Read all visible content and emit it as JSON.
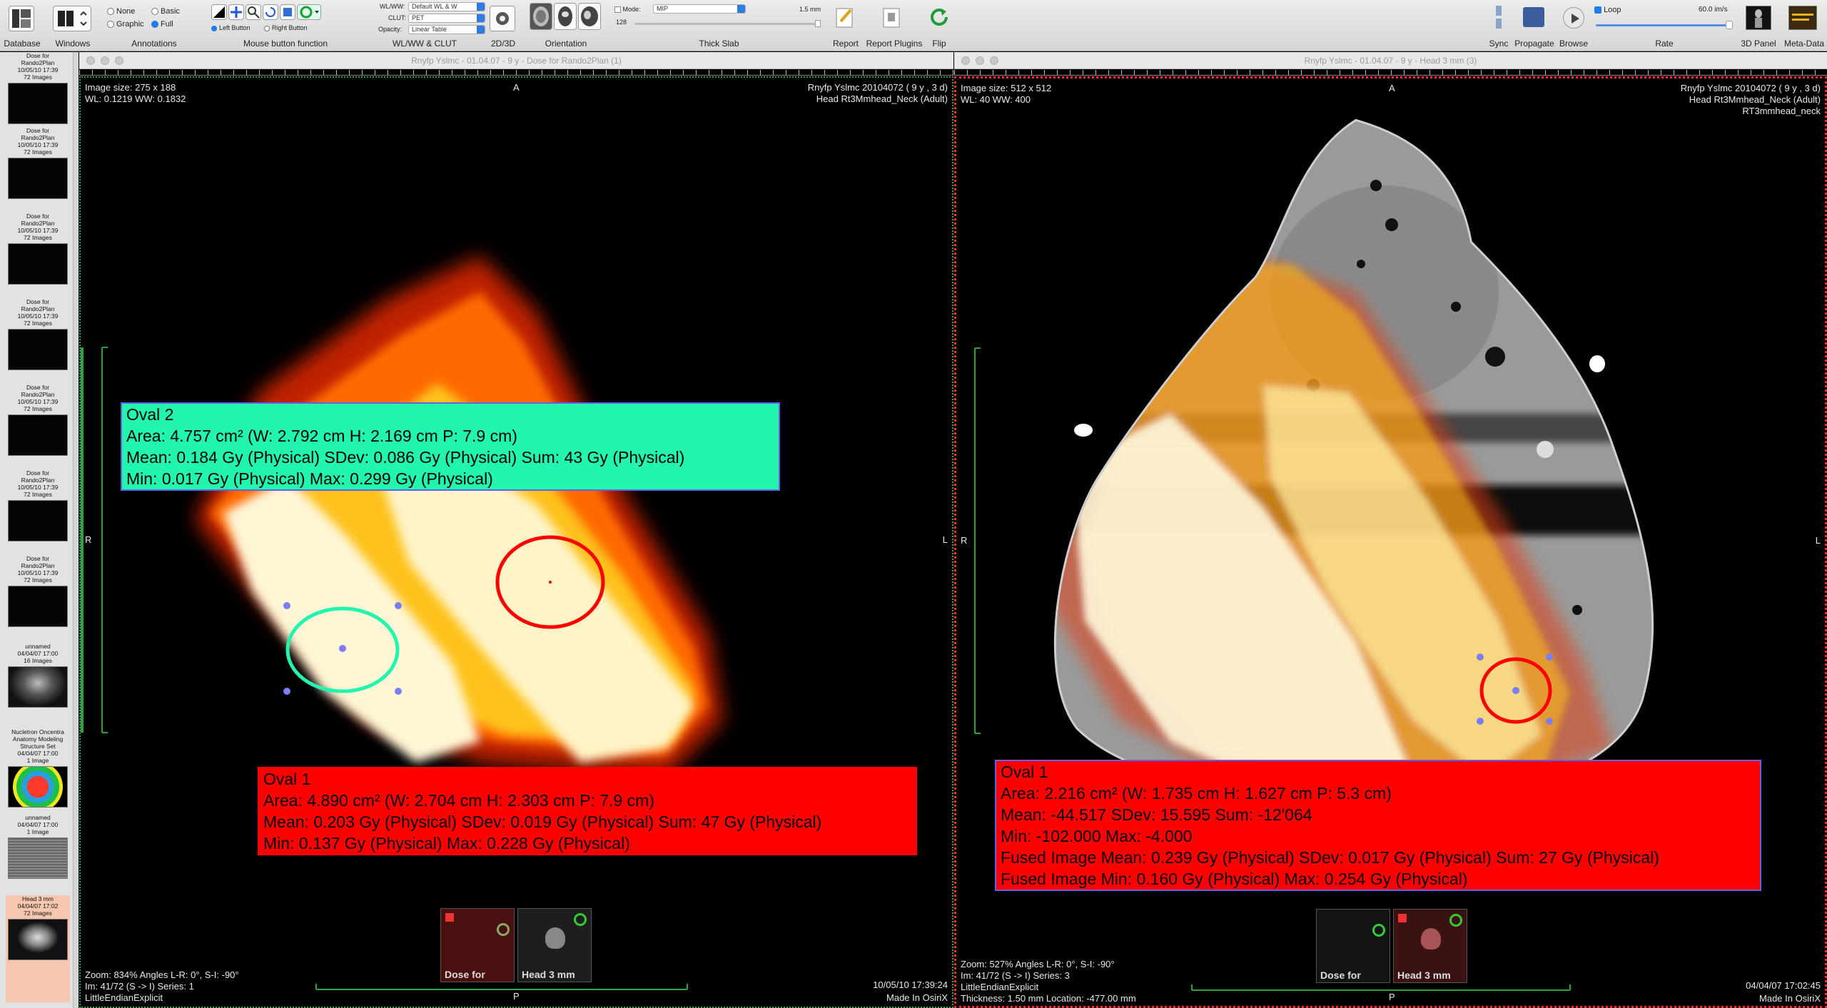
{
  "toolbar": {
    "database": "Database",
    "windows": "Windows",
    "annotations": {
      "label": "Annotations",
      "none": "None",
      "basic": "Basic",
      "graphic": "Graphic",
      "full": "Full"
    },
    "mouse": {
      "label": "Mouse button function",
      "left": "Left Button",
      "right": "Right Button"
    },
    "wlww_clut": {
      "label": "WL/WW & CLUT",
      "wlww_label": "WL/WW:",
      "wlww_value": "Default WL & W",
      "clut_label": "CLUT:",
      "clut_value": "PET",
      "opacity_label": "Opacity:",
      "opacity_value": "Linear Table"
    },
    "twod3d": "2D/3D",
    "orientation": "Orientation",
    "thick_slab": {
      "label": "Thick Slab",
      "mode_label": "Mode:",
      "mode_value": "MIP",
      "thickness": "1.5 mm",
      "count": "128"
    },
    "report": "Report",
    "report_plugins": "Report Plugins",
    "flip": "Flip",
    "sync": "Sync",
    "propagate": "Propagate",
    "browse": "Browse",
    "loop": "Loop",
    "rate": "Rate",
    "rate_value": "60.0 im/s",
    "panel_3d": "3D Panel",
    "metadata": "Meta-Data"
  },
  "sidebar": {
    "items": [
      {
        "l1": "Dose for",
        "l2": "Rando2Plan",
        "l3": "10/05/10 17:39",
        "l4": "72 Images"
      },
      {
        "l1": "Dose for",
        "l2": "Rando2Plan",
        "l3": "10/05/10 17:39",
        "l4": "72 Images"
      },
      {
        "l1": "Dose for",
        "l2": "Rando2Plan",
        "l3": "10/05/10 17:39",
        "l4": "72 Images"
      },
      {
        "l1": "Dose for",
        "l2": "Rando2Plan",
        "l3": "10/05/10 17:39",
        "l4": "72 Images"
      },
      {
        "l1": "Dose for",
        "l2": "Rando2Plan",
        "l3": "10/05/10 17:39",
        "l4": "72 Images"
      },
      {
        "l1": "Dose for",
        "l2": "Rando2Plan",
        "l3": "10/05/10 17:39",
        "l4": "72 Images"
      },
      {
        "l1": "Dose for",
        "l2": "Rando2Plan",
        "l3": "10/05/10 17:39",
        "l4": "72 Images"
      },
      {
        "l1": "unnamed",
        "l2": "04/04/07 17:00",
        "l3": "16 Images",
        "l4": ""
      },
      {
        "l1": "Nucletron Oncentra",
        "l2": "Anatomy Modeling",
        "l3": "Structure Set",
        "l4": "04/04/07 17:00",
        "l5": "1 Image"
      },
      {
        "l1": "unnamed",
        "l2": "04/04/07 17:00",
        "l3": "1 Image",
        "l4": ""
      },
      {
        "l1": "Head 3 mm",
        "l2": "04/04/07 17:02",
        "l3": "72 Images",
        "l4": ""
      }
    ]
  },
  "left_window": {
    "title": "Rnyfp Yslmc - 01.04.07 - 9 y - Dose for Rando2Plan (1)",
    "image_size": "Image size: 275 x 188",
    "wl_ww": "WL: 0.1219 WW: 0.1832",
    "patient": "Rnyfp Yslmc 20104072 ( 9 y , 3 d)",
    "study": "Head Rt3Mmhead_Neck (Adult)",
    "orient_top": "A",
    "orient_left": "R",
    "orient_right": "L",
    "orient_bottom": "P",
    "zoom": "Zoom: 834% Angles L-R: 0°, S-I: -90°",
    "im": "Im: 41/72  (S -> I) Series: 1",
    "encoding": "LittleEndianExplicit",
    "datetime": "10/05/10 17:39:24",
    "made_in": "Made In OsiriX",
    "roi_oval2": {
      "title": "Oval 2",
      "line1": "Area: 4.757 cm² (W: 2.792 cm H: 2.169 cm P: 7.9 cm)",
      "line2": "Mean: 0.184 Gy (Physical)  SDev: 0.086 Gy (Physical)  Sum: 43 Gy (Physical)",
      "line3": "Min: 0.017 Gy (Physical)  Max: 0.299 Gy (Physical)"
    },
    "roi_oval1": {
      "title": "Oval 1",
      "line1": "Area: 4.890 cm² (W: 2.704 cm H: 2.303 cm P: 7.9 cm)",
      "line2": "Mean: 0.203 Gy (Physical)  SDev: 0.019 Gy (Physical)  Sum: 47 Gy (Physical)",
      "line3": "Min: 0.137 Gy (Physical)  Max: 0.228 Gy (Physical)"
    },
    "minis": [
      "Dose for",
      "Head 3 mm"
    ]
  },
  "right_window": {
    "title": "Rnyfp Yslmc - 01.04.07 - 9 y - Head 3 mm (3)",
    "image_size": "Image size: 512 x 512",
    "wl_ww": "WL: 40 WW: 400",
    "patient": "Rnyfp Yslmc 20104072 ( 9 y , 3 d)",
    "study": "Head Rt3Mmhead_Neck (Adult)",
    "series": "RT3mmhead_neck",
    "orient_top": "A",
    "orient_left": "R",
    "orient_right": "L",
    "orient_bottom": "P",
    "zoom": "Zoom: 527% Angles L-R: 0°, S-I: -90°",
    "im": "Im: 41/72  (S -> I) Series: 3",
    "encoding": "LittleEndianExplicit",
    "thickness": "Thickness: 1.50 mm Location: -477.00 mm",
    "datetime": "04/04/07 17:02:45",
    "made_in": "Made In OsiriX",
    "roi_oval1": {
      "title": "Oval 1",
      "line1": "Area: 2.216 cm² (W: 1.735 cm H: 1.627 cm P: 5.3 cm)",
      "line2": "Mean: -44.517   SDev: 15.595   Sum: -12'064",
      "line3": "Min: -102.000   Max: -4.000",
      "line4": "Fused Image Mean: 0.239 Gy (Physical)  SDev: 0.017 Gy (Physical)  Sum: 27 Gy (Physical)",
      "line5": "Fused Image Min: 0.160 Gy (Physical)  Max: 0.254 Gy (Physical)"
    },
    "minis": [
      "Dose for",
      "Head 3 mm"
    ]
  },
  "colors": {
    "roi_cyan": "#22f5b0",
    "roi_red": "#ff0000",
    "handle": "#7b7ff2",
    "accent": "#1f7ce8"
  }
}
